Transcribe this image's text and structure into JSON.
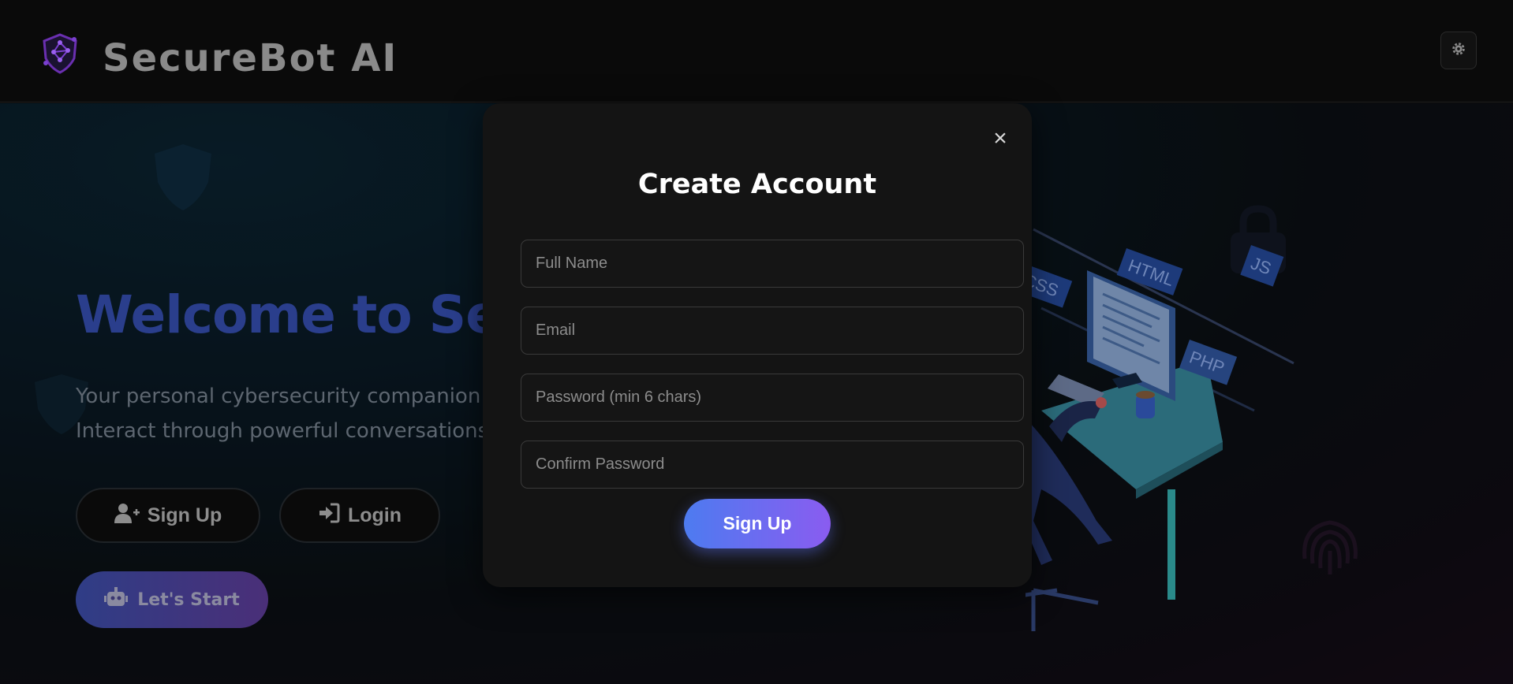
{
  "header": {
    "brand": "SecureBot AI",
    "logo_icon": "shield-network-icon",
    "theme_icon": "gear-icon"
  },
  "hero": {
    "title": "Welcome to Secu",
    "subtitle_line1": "Your personal cybersecurity companion. Tra",
    "subtitle_line2": "Interact through powerful conversations ar",
    "signup_label": "Sign Up",
    "signup_icon": "user-plus-icon",
    "login_label": "Login",
    "login_icon": "sign-in-icon",
    "start_label": "Let's Start",
    "start_icon": "robot-icon"
  },
  "illustration": {
    "tags": [
      "HTML",
      "CSS",
      "JS",
      "PHP"
    ]
  },
  "modal": {
    "title": "Create Account",
    "close_label": "×",
    "fields": {
      "full_name_placeholder": "Full Name",
      "email_placeholder": "Email",
      "password_placeholder": "Password (min 6 chars)",
      "confirm_placeholder": "Confirm Password"
    },
    "submit_label": "Sign Up"
  },
  "colors": {
    "accent_start": "#4d7bf0",
    "accent_end": "#8a5cf0",
    "modal_bg": "#141414",
    "page_bg": "#0a0a0a"
  }
}
